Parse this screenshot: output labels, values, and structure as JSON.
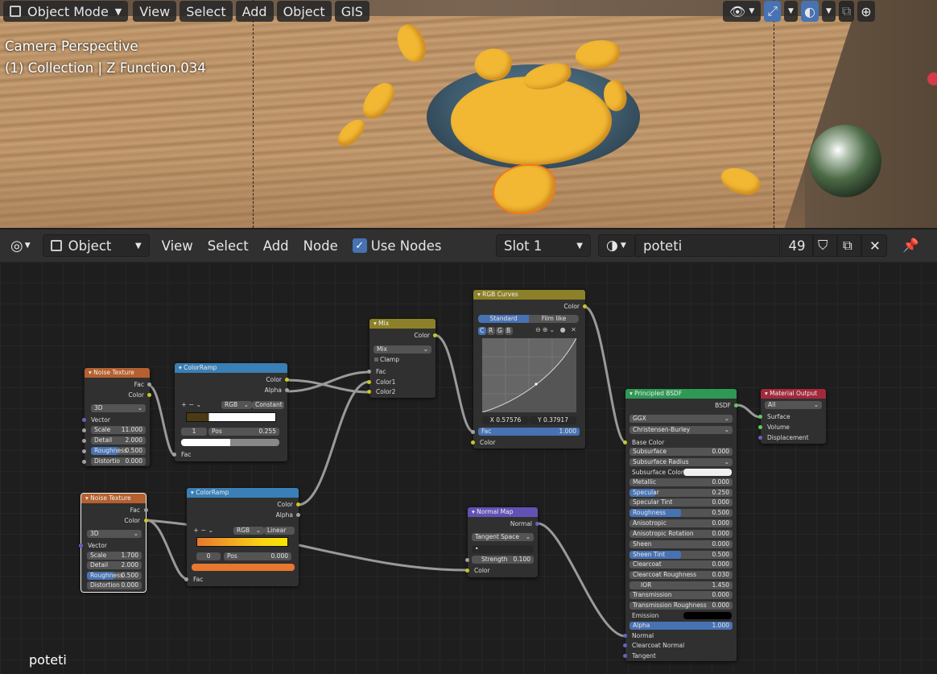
{
  "viewport": {
    "mode_label": "Object Mode",
    "menu": [
      "View",
      "Select",
      "Add",
      "Object",
      "GIS"
    ],
    "info_line1": "Camera Perspective",
    "info_line2": "(1) Collection | Z Function.034"
  },
  "node_header": {
    "editor_type": "Object",
    "menu": [
      "View",
      "Select",
      "Add",
      "Node"
    ],
    "use_nodes_label": "Use Nodes",
    "use_nodes_checked": true,
    "slot": "Slot 1",
    "material_name": "poteti",
    "users": "49"
  },
  "material_label": "poteti",
  "nodes": {
    "noise1": {
      "title": "Noise Texture",
      "out1": "Fac",
      "out2": "Color",
      "dim": "3D",
      "vector": "Vector",
      "scale_l": "Scale",
      "scale_v": "11.000",
      "detail_l": "Detail",
      "detail_v": "2.000",
      "rough_l": "Roughness",
      "rough_v": "0.500",
      "dist_l": "Distortio",
      "dist_v": "0.000"
    },
    "ramp1": {
      "title": "ColorRamp",
      "out1": "Color",
      "out2": "Alpha",
      "mode": "RGB",
      "interp": "Constant",
      "idx": "1",
      "pos_l": "Pos",
      "pos_v": "0.255",
      "in": "Fac"
    },
    "noise2": {
      "title": "Noise Texture",
      "out1": "Fac",
      "out2": "Color",
      "dim": "3D",
      "vector": "Vector",
      "scale_l": "Scale",
      "scale_v": "1.700",
      "detail_l": "Detail",
      "detail_v": "2.000",
      "rough_l": "Roughness",
      "rough_v": "0.500",
      "dist_l": "Distortion",
      "dist_v": "0.000"
    },
    "ramp2": {
      "title": "ColorRamp",
      "out1": "Color",
      "out2": "Alpha",
      "mode": "RGB",
      "interp": "Linear",
      "idx": "0",
      "pos_l": "Pos",
      "pos_v": "0.000",
      "in": "Fac"
    },
    "mix": {
      "title": "Mix",
      "out": "Color",
      "blend": "Mix",
      "clamp": "Clamp",
      "fac": "Fac",
      "c1": "Color1",
      "c2": "Color2"
    },
    "curves": {
      "title": "RGB Curves",
      "out": "Color",
      "tab1": "Standard",
      "tab2": "Film like",
      "ch": [
        "C",
        "R",
        "G",
        "B"
      ],
      "x": "X 0.57576",
      "y": "Y 0.37917",
      "fac_l": "Fac",
      "fac_v": "1.000",
      "in": "Color"
    },
    "normal": {
      "title": "Normal Map",
      "out": "Normal",
      "space": "Tangent Space",
      "str_l": "Strength",
      "str_v": "0.100",
      "in": "Color"
    },
    "bsdf": {
      "title": "Principled BSDF",
      "out": "BSDF",
      "dist": "GGX",
      "sss": "Christensen-Burley",
      "base": "Base Color",
      "rows": [
        [
          "Subsurface",
          "0.000"
        ],
        [
          "Subsurface Radius",
          ""
        ],
        [
          "Subsurface Color",
          ""
        ],
        [
          "Metallic",
          "0.000"
        ],
        [
          "Specular",
          "0.250"
        ],
        [
          "Specular Tint",
          "0.000"
        ],
        [
          "Roughness",
          "0.500"
        ],
        [
          "Anisotropic",
          "0.000"
        ],
        [
          "Anisotropic Rotation",
          "0.000"
        ],
        [
          "Sheen",
          "0.000"
        ],
        [
          "Sheen Tint",
          "0.500"
        ],
        [
          "Clearcoat",
          "0.000"
        ],
        [
          "Clearcoat Roughness",
          "0.030"
        ],
        [
          "IOR",
          "1.450"
        ],
        [
          "Transmission",
          "0.000"
        ],
        [
          "Transmission Roughness",
          "0.000"
        ],
        [
          "Emission",
          ""
        ],
        [
          "Alpha",
          "1.000"
        ]
      ],
      "tail": [
        "Normal",
        "Clearcoat Normal",
        "Tangent"
      ]
    },
    "output": {
      "title": "Material Output",
      "target": "All",
      "s1": "Surface",
      "s2": "Volume",
      "s3": "Displacement"
    }
  }
}
